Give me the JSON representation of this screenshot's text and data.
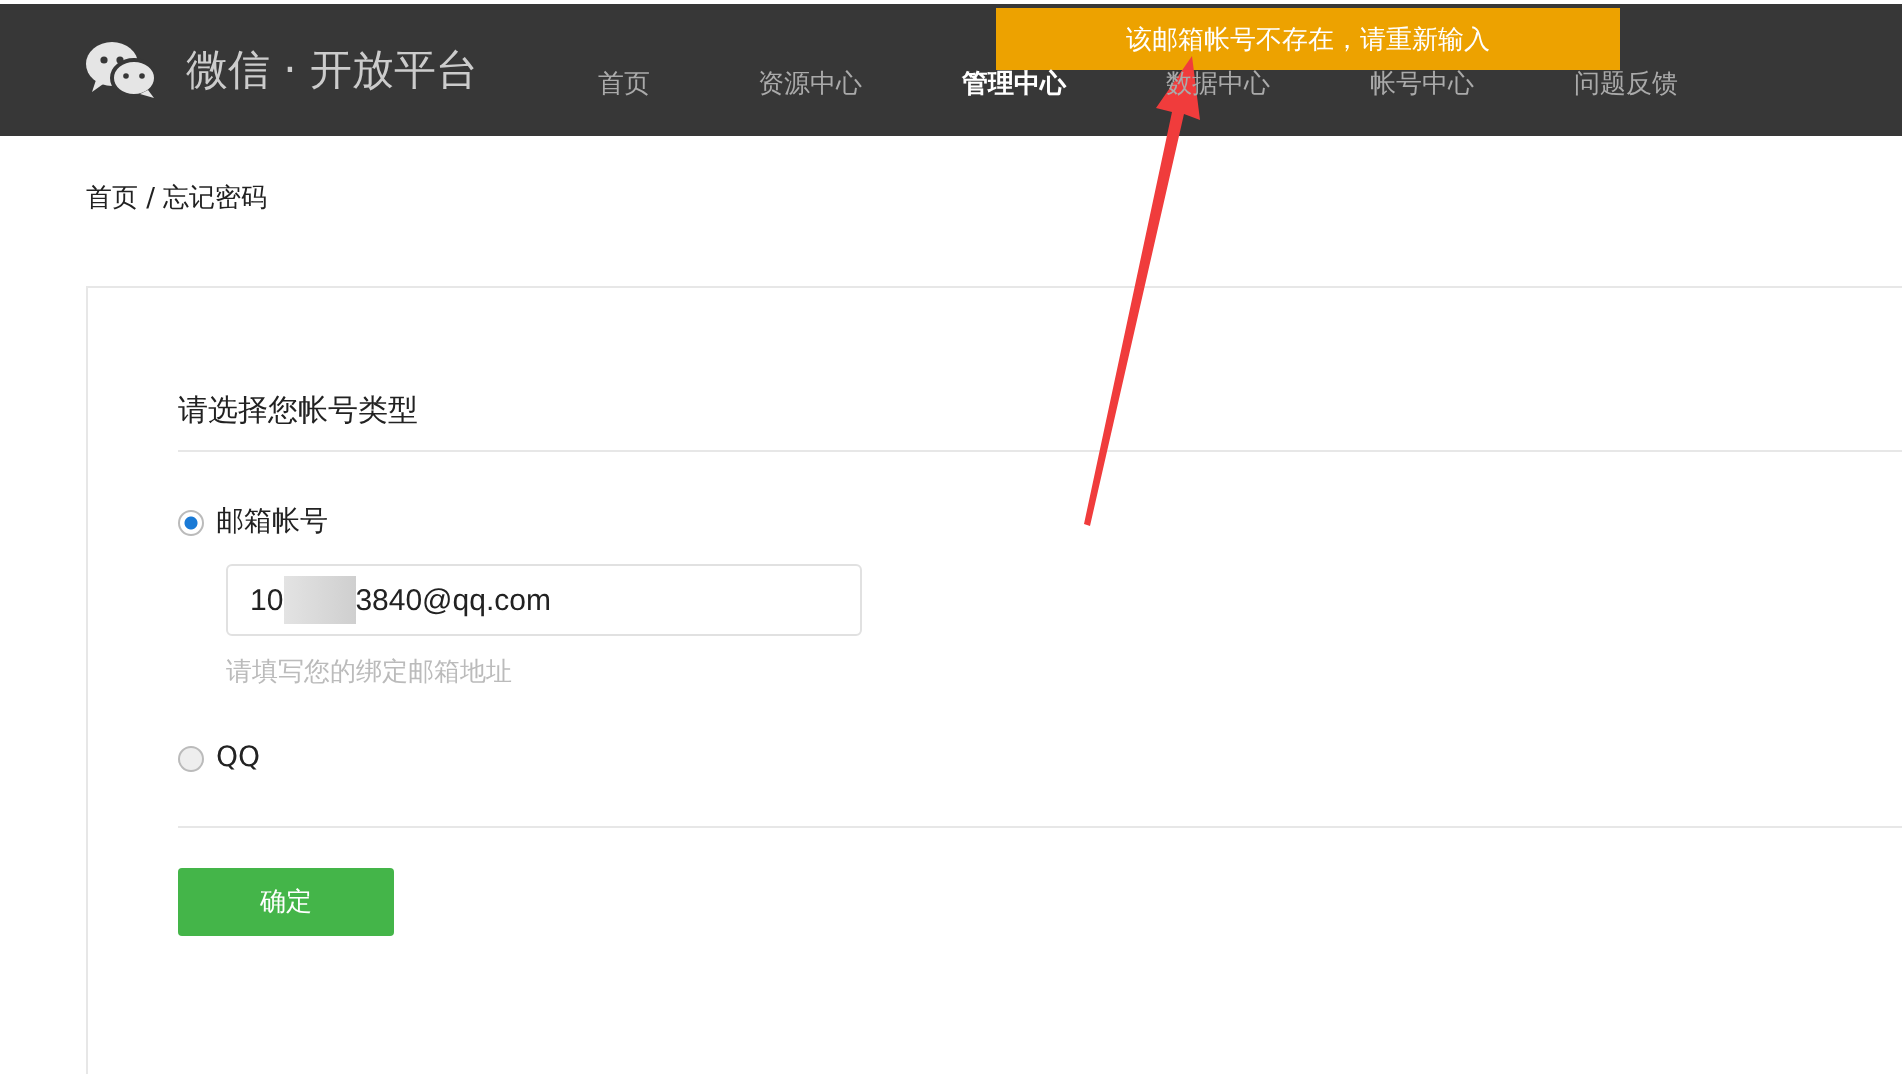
{
  "header": {
    "title": "微信 · 开放平台",
    "nav": [
      {
        "label": "首页",
        "selected": false
      },
      {
        "label": "资源中心",
        "selected": false
      },
      {
        "label": "管理中心",
        "selected": true
      },
      {
        "label": "数据中心",
        "selected": false
      },
      {
        "label": "帐号中心",
        "selected": false
      },
      {
        "label": "问题反馈",
        "selected": false
      }
    ]
  },
  "toast": "该邮箱帐号不存在，请重新输入",
  "breadcrumb": "首页 / 忘记密码",
  "form": {
    "title": "请选择您帐号类型",
    "options": [
      {
        "label": "邮箱帐号",
        "selected": true,
        "value_start": "10",
        "value_end": "3840@qq.com",
        "hint": "请填写您的绑定邮箱地址"
      },
      {
        "label": "QQ",
        "selected": false
      }
    ],
    "submit": "确定"
  }
}
